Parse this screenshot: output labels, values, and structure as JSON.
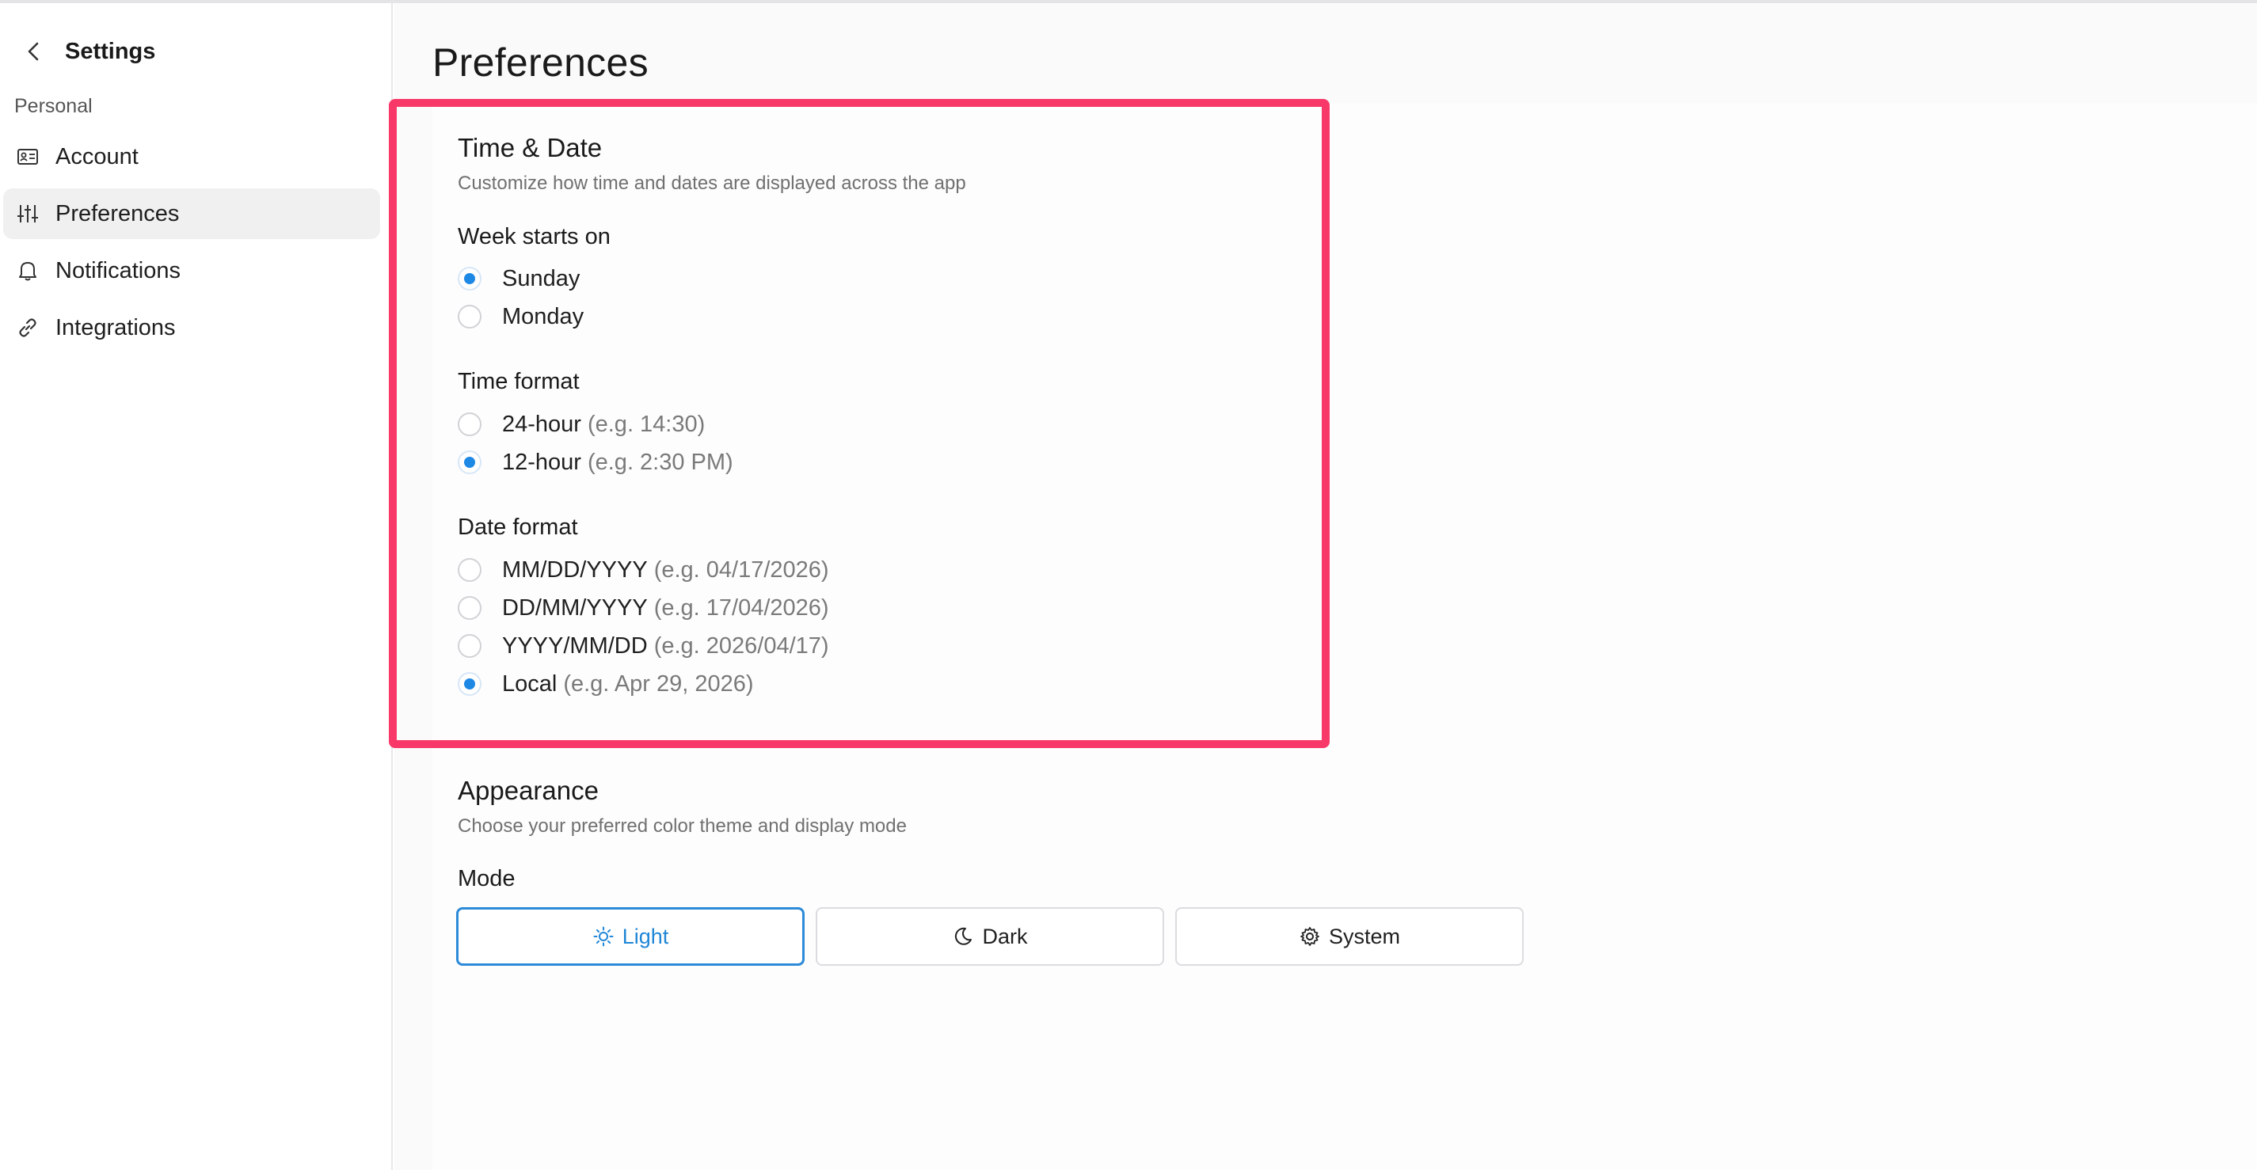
{
  "sidebar": {
    "title": "Settings",
    "section": "Personal",
    "items": [
      {
        "label": "Account",
        "icon": "id-card-icon"
      },
      {
        "label": "Preferences",
        "icon": "sliders-icon",
        "active": true
      },
      {
        "label": "Notifications",
        "icon": "bell-icon"
      },
      {
        "label": "Integrations",
        "icon": "link-icon"
      }
    ]
  },
  "main": {
    "title": "Preferences",
    "time_date": {
      "title": "Time & Date",
      "description": "Customize how time and dates are displayed across the app",
      "week_start": {
        "label": "Week starts on",
        "options": [
          {
            "label": "Sunday",
            "selected": true
          },
          {
            "label": "Monday",
            "selected": false
          }
        ]
      },
      "time_format": {
        "label": "Time format",
        "options": [
          {
            "label": "24-hour",
            "hint": "(e.g. 14:30)",
            "selected": false
          },
          {
            "label": "12-hour",
            "hint": "(e.g. 2:30 PM)",
            "selected": true
          }
        ]
      },
      "date_format": {
        "label": "Date format",
        "options": [
          {
            "label": "MM/DD/YYYY",
            "hint": "(e.g. 04/17/2026)",
            "selected": false
          },
          {
            "label": "DD/MM/YYYY",
            "hint": "(e.g. 17/04/2026)",
            "selected": false
          },
          {
            "label": "YYYY/MM/DD",
            "hint": "(e.g. 2026/04/17)",
            "selected": false
          },
          {
            "label": "Local",
            "hint": "(e.g. Apr 29, 2026)",
            "selected": true
          }
        ]
      }
    },
    "appearance": {
      "title": "Appearance",
      "description": "Choose your preferred color theme and display mode",
      "mode_label": "Mode",
      "modes": [
        {
          "label": "Light",
          "icon": "sun-icon",
          "active": true
        },
        {
          "label": "Dark",
          "icon": "moon-icon",
          "active": false
        },
        {
          "label": "System",
          "icon": "gear-icon",
          "active": false
        }
      ]
    }
  },
  "colors": {
    "accent": "#1e88e5",
    "highlight": "#f73868",
    "active_nav_bg": "#f0f0f1"
  }
}
